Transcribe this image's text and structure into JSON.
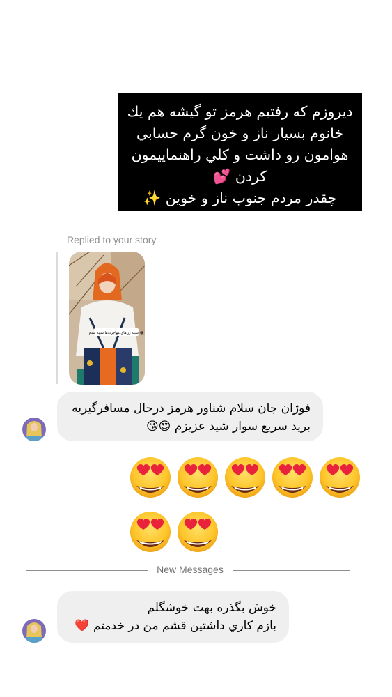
{
  "story_reply_message": {
    "text": "ديروزم كه رفتيم هرمز تو گيشه هم يك\nخانوم بسيار ناز و خون گرم حسابي\nهوامون رو داشت و كلي راهنماييمون\nكردن 💕\nچقدر مردم جنوب ناز و خوين ✨"
  },
  "replied_label": "Replied to your story",
  "story_thumbnail": {
    "caption": "شبیه زن‌های مهاجرت‌ها شبیه شدم 😂"
  },
  "message_1": {
    "line1": "فوژان جان سلام شناور هرمز درحال مسافرگيريه",
    "line2": "بريد سريع سوار شيد عزيزم 😍😘"
  },
  "emoji_reaction": {
    "row1": [
      "😍",
      "😍",
      "😍",
      "😍",
      "😍"
    ],
    "row2": [
      "😍",
      "😍"
    ]
  },
  "divider": {
    "label": "New Messages"
  },
  "message_2": {
    "line1": "خوش بگذره بهت خوشگلم",
    "line2": "بازم كاري داشتين قشم من در خدمتم ❤️"
  },
  "colors": {
    "bubble_bg": "#efefef",
    "label_gray": "#8e8e8e",
    "black_message": "#000000"
  }
}
